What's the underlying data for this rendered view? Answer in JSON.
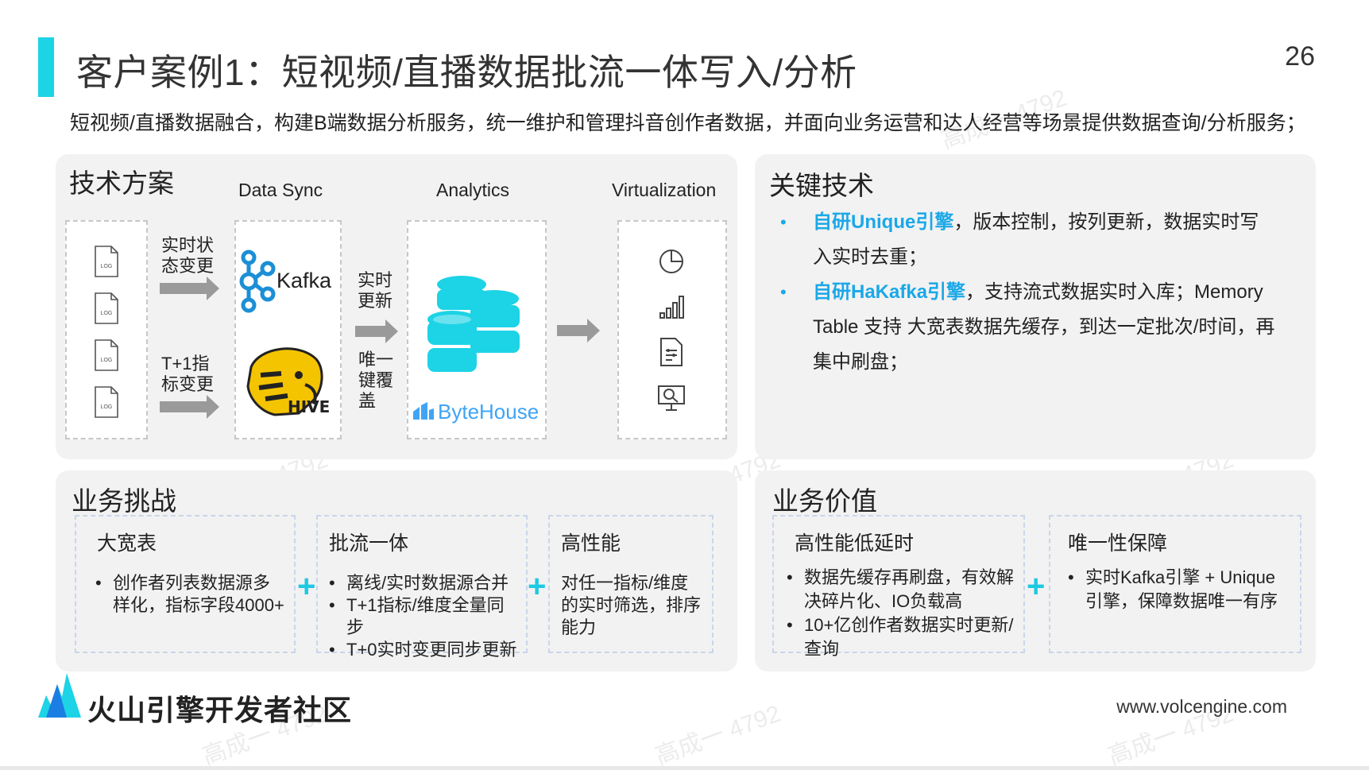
{
  "title": "客户案例1：短视频/直播数据批流一体写入/分析",
  "page_number": "26",
  "subtitle": "短视频/直播数据融合，构建B端数据分析服务，统一维护和管理抖音创作者数据，并面向业务运营和达人经营等场景提供数据查询/分析服务；",
  "tech_solution": {
    "title": "技术方案",
    "col_data_sync": "Data Sync",
    "col_analytics": "Analytics",
    "col_virtualization": "Virtualization",
    "log_icon_text": "LOG",
    "flow_realtime_state": "实时状态变更",
    "flow_t1_metric": "T+1指标变更",
    "flow_realtime_update": "实时更新",
    "flow_unique_key": "唯一键覆盖",
    "kafka_label": "Kafka",
    "hive_label": "HIVE",
    "bytehouse_label": "ByteHouse"
  },
  "key_tech": {
    "title": "关键技术",
    "items": [
      {
        "highlight": "自研Unique引擎",
        "text": "，版本控制，按列更新，数据实时写入实时去重；"
      },
      {
        "highlight": "自研HaKafka引擎",
        "text": "，支持流式数据实时入库；Memory Table 支持 大宽表数据先缓存，到达一定批次/时间，再集中刷盘；"
      }
    ]
  },
  "business_challenge": {
    "title": "业务挑战",
    "cards": [
      {
        "title": "大宽表",
        "items": [
          "创作者列表数据源多样化，指标字段4000+"
        ]
      },
      {
        "title": "批流一体",
        "items": [
          "离线/实时数据源合并",
          "T+1指标/维度全量同步",
          "T+0实时变更同步更新"
        ]
      },
      {
        "title": "高性能",
        "text": "对任一指标/维度的实时筛选，排序能力"
      }
    ],
    "plus": "+"
  },
  "business_value": {
    "title": "业务价值",
    "cards": [
      {
        "title": "高性能低延时",
        "items": [
          "数据先缓存再刷盘，有效解决碎片化、IO负载高",
          "10+亿创作者数据实时更新/查询"
        ]
      },
      {
        "title": "唯一性保障",
        "items": [
          "实时Kafka引擎 + Unique引擎，保障数据唯一有序"
        ]
      }
    ],
    "plus": "+"
  },
  "footer": {
    "brand": "火山引擎开发者社区",
    "url": "www.volcengine.com"
  },
  "watermark": "高成一 4792",
  "colors": {
    "accent": "#1dd3e6",
    "highlight": "#1aa8e8",
    "bytehouse": "#3fa4f5",
    "hive_yellow": "#f5c400"
  }
}
